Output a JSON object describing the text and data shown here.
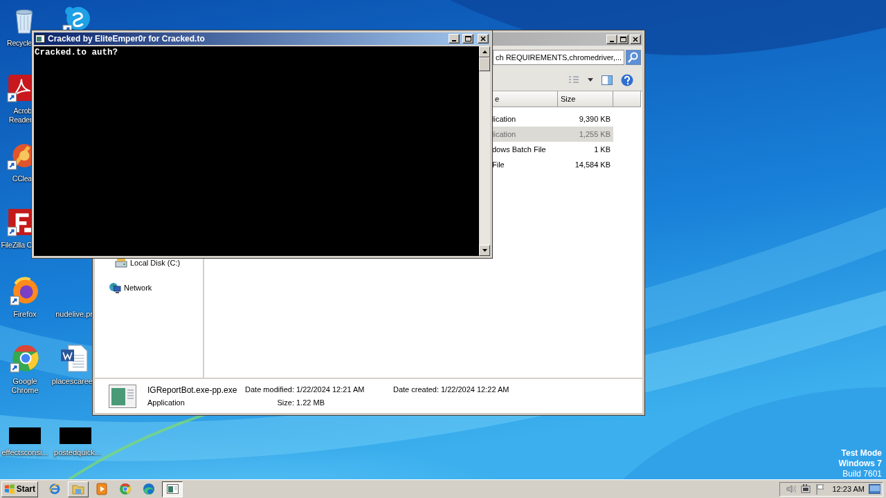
{
  "desktop": {
    "icons": [
      {
        "kind": "bin",
        "label": "Recycle"
      },
      {
        "kind": "chat"
      },
      {
        "kind": "pdf",
        "label": "Acrob Reader"
      },
      {
        "kind": "cleaner",
        "label": "CClea"
      },
      {
        "kind": "ftp",
        "label": "FileZilla C"
      },
      {
        "kind": "fox",
        "label": "Firefox"
      },
      {
        "kind": "none",
        "label": "nudelive.pr"
      },
      {
        "kind": "chrome",
        "label": "Google Chrome"
      },
      {
        "kind": "doc",
        "label": "placescaree"
      },
      {
        "kind": "thumb",
        "label": "effectsconsi..."
      },
      {
        "kind": "thumb",
        "label": "postedquick..."
      }
    ]
  },
  "console": {
    "title": "Cracked by EliteEmper0r for Cracked.to",
    "lines": [
      "Cracked.to auth?"
    ]
  },
  "explorer": {
    "search": {
      "value": "ch REQUIREMENTS,chromedriver,..."
    },
    "columns": [
      "e",
      "Size"
    ],
    "rows": [
      {
        "name": "lication",
        "size": "9,390 KB",
        "selected": false
      },
      {
        "name": "lication",
        "size": "1,255 KB",
        "selected": true
      },
      {
        "name": "dows Batch File",
        "size": "1 KB",
        "selected": false
      },
      {
        "name": "File",
        "size": "14,584 KB",
        "selected": false
      }
    ],
    "nav": [
      {
        "kind": "drive",
        "label": "Local Disk (C:)"
      },
      {
        "kind": "network",
        "label": "Network"
      }
    ],
    "details": {
      "name": "IGReportBot.exe-pp.exe",
      "type": "Application",
      "fields": [
        {
          "label": "Date modified:",
          "value": "1/22/2024 12:21 AM"
        },
        {
          "label": "Size:",
          "value": "1.22 MB"
        },
        {
          "label": "Date created:",
          "value": "1/22/2024 12:22 AM"
        }
      ]
    }
  },
  "watermark": [
    "Test Mode",
    "Windows 7",
    "Build 7601"
  ],
  "taskbar": {
    "start": "Start",
    "buttons": [
      {
        "kind": "ie",
        "open": false,
        "active": false
      },
      {
        "kind": "folder",
        "open": true,
        "active": false
      },
      {
        "kind": "media",
        "open": false,
        "active": false
      },
      {
        "kind": "chrome",
        "open": false,
        "active": false
      },
      {
        "kind": "edge",
        "open": false,
        "active": false
      },
      {
        "kind": "console",
        "open": true,
        "active": true
      }
    ],
    "clock": "12:23 AM"
  }
}
